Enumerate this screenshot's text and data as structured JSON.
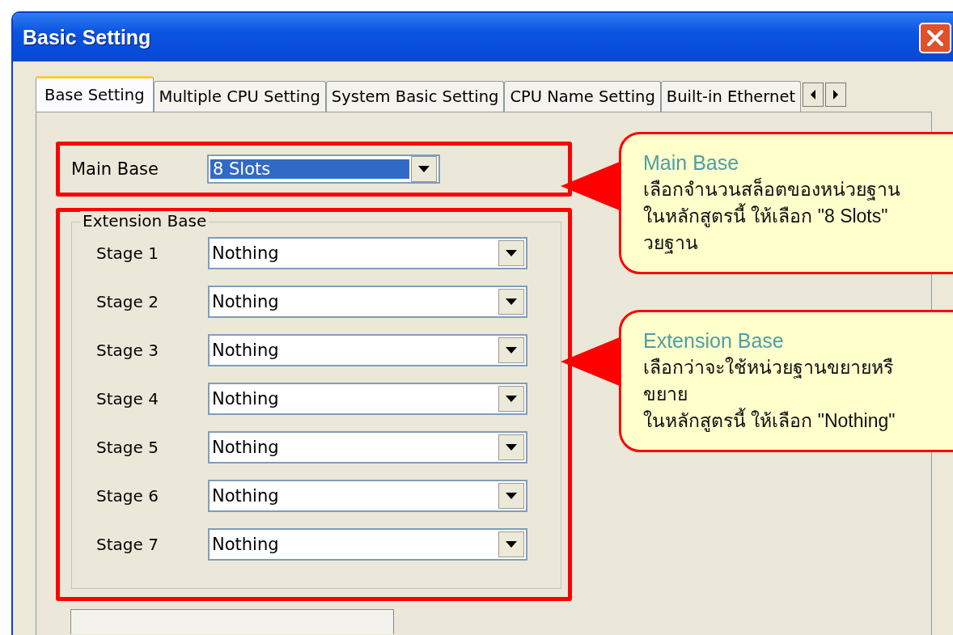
{
  "window": {
    "title": "Basic Setting"
  },
  "tabs": [
    {
      "label": "Base Setting",
      "selected": true
    },
    {
      "label": "Multiple CPU Setting",
      "selected": false
    },
    {
      "label": "System Basic Setting",
      "selected": false
    },
    {
      "label": "CPU Name Setting",
      "selected": false
    },
    {
      "label": "Built-in Ethernet",
      "selected": false
    }
  ],
  "main_base": {
    "label": "Main Base",
    "value": "8 Slots",
    "focused": true
  },
  "extension_base": {
    "title": "Extension Base",
    "stages": [
      {
        "label": "Stage 1",
        "value": "Nothing"
      },
      {
        "label": "Stage 2",
        "value": "Nothing"
      },
      {
        "label": "Stage 3",
        "value": "Nothing"
      },
      {
        "label": "Stage 4",
        "value": "Nothing"
      },
      {
        "label": "Stage 5",
        "value": "Nothing"
      },
      {
        "label": "Stage 6",
        "value": "Nothing"
      },
      {
        "label": "Stage 7",
        "value": "Nothing"
      }
    ]
  },
  "callouts": [
    {
      "title": "Main Base",
      "lines": [
        "เลือกจำนวนสล็อตของหน่วยฐาน",
        "ในหลักสูตรนี้ ให้เลือก \"8 Slots\"",
        "วยฐาน"
      ]
    },
    {
      "title": "Extension Base",
      "lines": [
        "เลือกว่าจะใช้หน่วยฐานขยายหรื",
        "ขยาย",
        "ในหลักสูตรนี้ ให้เลือก \"Nothing\""
      ]
    }
  ]
}
